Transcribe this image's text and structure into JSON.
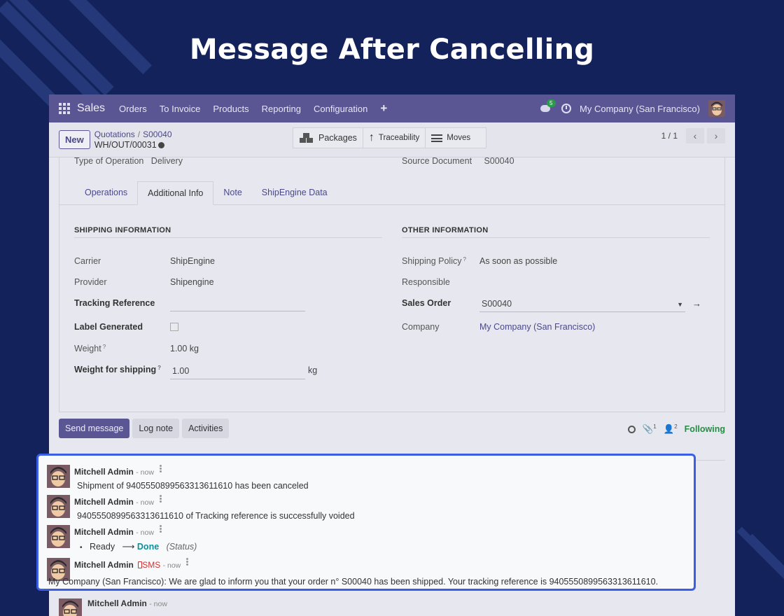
{
  "headline": "Message After Cancelling",
  "topbar": {
    "app": "Sales",
    "menus": [
      "Orders",
      "To Invoice",
      "Products",
      "Reporting",
      "Configuration"
    ],
    "plus": "+",
    "chat_count": "5",
    "company": "My Company (San Francisco)"
  },
  "control": {
    "new_label": "New",
    "crumb_parent": "Quotations",
    "crumb_sep": "/",
    "crumb_order": "S00040",
    "record": "WH/OUT/00031",
    "smart": [
      "Packages",
      "Traceability",
      "Moves"
    ],
    "pager": "1 / 1"
  },
  "cutoff": {
    "op_label": "Type of Operation",
    "op_value": "Delivery",
    "src_label": "Source Document",
    "src_value": "S00040"
  },
  "tabs": [
    "Operations",
    "Additional Info",
    "Note",
    "ShipEngine Data"
  ],
  "shipping": {
    "title": "SHIPPING INFORMATION",
    "carrier_label": "Carrier",
    "carrier": "ShipEngine",
    "provider_label": "Provider",
    "provider": "Shipengine",
    "tracking_label": "Tracking Reference",
    "label_generated_label": "Label Generated",
    "weight_label": "Weight",
    "weight": "1.00 kg",
    "wfs_label": "Weight for shipping",
    "wfs": "1.00",
    "wfs_unit": "kg",
    "help": "?"
  },
  "other": {
    "title": "OTHER INFORMATION",
    "policy_label": "Shipping Policy",
    "policy": "As soon as possible",
    "responsible_label": "Responsible",
    "so_label": "Sales Order",
    "so": "S00040",
    "company_label": "Company",
    "company": "My Company (San Francisco)"
  },
  "chatter": {
    "send": "Send message",
    "log": "Log note",
    "activities": "Activities",
    "attach_count": "1",
    "follower_count": "2",
    "following": "Following"
  },
  "messages": [
    {
      "author": "Mitchell Admin",
      "time": "- now",
      "text": "Shipment of 9405550899563313611610 has been canceled"
    },
    {
      "author": "Mitchell Admin",
      "time": "- now",
      "text": "9405550899563313611610 of Tracking reference is successfully voided"
    },
    {
      "author": "Mitchell Admin",
      "time": "- now",
      "bullet": "•",
      "old": "Ready",
      "new": "Done",
      "field": "(Status)"
    },
    {
      "author": "Mitchell Admin",
      "sms": "SMS",
      "time": "- now",
      "text": "My Company (San Francisco): We are glad to inform you that your order n° S00040 has been shipped. Your tracking reference is 9405550899563313611610."
    },
    {
      "author": "Mitchell Admin",
      "time": "- now"
    }
  ],
  "colors": {
    "background": "#13225a",
    "navbar": "#5a5694",
    "highlight_border": "#3a5ee6",
    "following": "#2b8a47",
    "status_done": "#0d8f9b",
    "sms": "#d12f2f"
  }
}
